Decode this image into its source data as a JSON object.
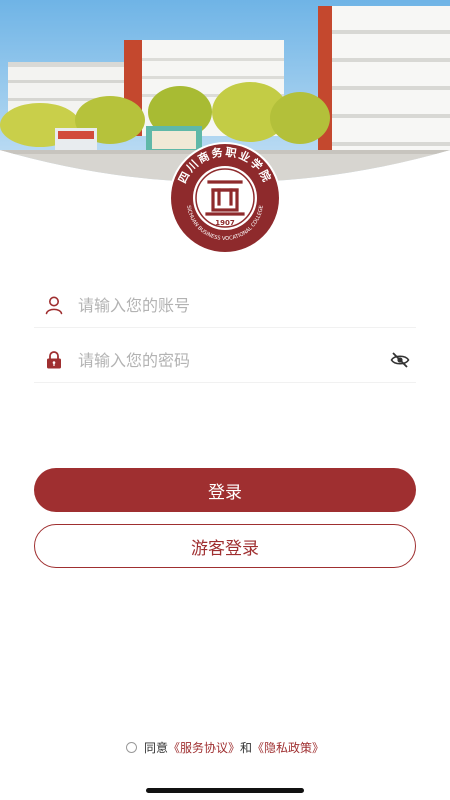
{
  "header": {
    "emblem": {
      "name_cn": "四川商务职业学院",
      "name_en": "SICHUAN BUSINESS VOCATIONAL COLLEGE",
      "year": "1907"
    }
  },
  "login": {
    "account_placeholder": "请输入您的账号",
    "password_placeholder": "请输入您的密码",
    "login_label": "登录",
    "guest_label": "游客登录"
  },
  "agreement": {
    "agree_text": "同意",
    "service_link": "《服务协议》",
    "and_text": "和",
    "privacy_link": "《隐私政策》"
  },
  "colors": {
    "brand": "#9f2f30",
    "placeholder": "#b3b3b3"
  },
  "icons": [
    "user-icon",
    "lock-icon",
    "eye-off-icon",
    "radio-icon"
  ]
}
